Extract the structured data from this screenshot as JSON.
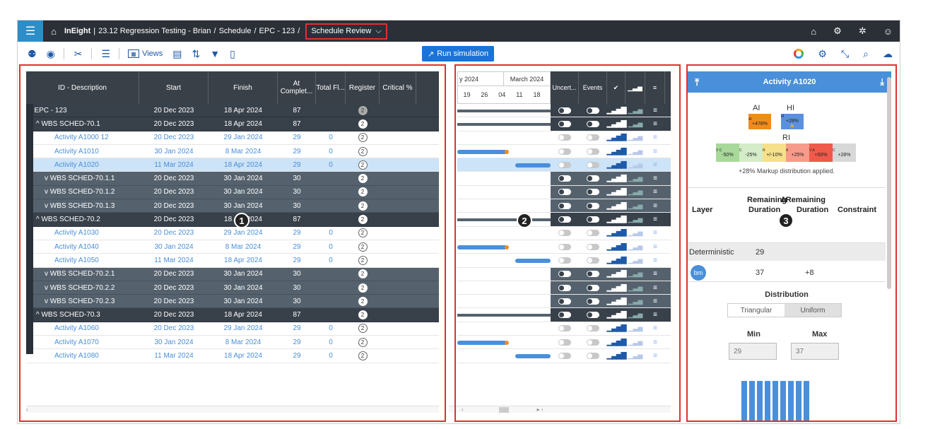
{
  "topbar": {
    "app": "InEight",
    "project": "23.12 Regression Testing - Brian",
    "path1": "Schedule",
    "path2": "EPC - 123",
    "current": "Schedule Review"
  },
  "toolbar": {
    "views_label": "Views",
    "run_label": "Run simulation"
  },
  "grid": {
    "headers": [
      "ID - Description",
      "Start",
      "Finish",
      "At Complet...",
      "Total Fl...",
      "Register",
      "Critical %"
    ],
    "rows": [
      {
        "kind": "dark",
        "r": "r0",
        "name": "^ EPC - 123",
        "start": "20 Dec 2023",
        "finish": "18 Apr 2024",
        "ac": "87",
        "tf": "",
        "reg": "2"
      },
      {
        "kind": "dark",
        "name": "^ WBS SCHED-70.1",
        "start": "20 Dec 2023",
        "finish": "18 Apr 2024",
        "ac": "87",
        "tf": "",
        "reg": "2"
      },
      {
        "kind": "act",
        "name": "Activity A1000 12",
        "start": "20 Dec 2023",
        "finish": "29 Jan 2024",
        "ac": "29",
        "tf": "0",
        "reg": "2"
      },
      {
        "kind": "act",
        "name": "Activity A1010",
        "start": "30 Jan 2024",
        "finish": "8 Mar 2024",
        "ac": "29",
        "tf": "0",
        "reg": "2"
      },
      {
        "kind": "sel",
        "name": "Activity A1020",
        "start": "11 Mar 2024",
        "finish": "18 Apr 2024",
        "ac": "29",
        "tf": "0",
        "reg": "2"
      },
      {
        "kind": "mid",
        "name": "v WBS SCHED-70.1.1",
        "start": "20 Dec 2023",
        "finish": "30 Jan 2024",
        "ac": "30",
        "tf": "",
        "reg": "2"
      },
      {
        "kind": "mid",
        "name": "v WBS SCHED-70.1.2",
        "start": "20 Dec 2023",
        "finish": "30 Jan 2024",
        "ac": "30",
        "tf": "",
        "reg": "2"
      },
      {
        "kind": "mid",
        "name": "v WBS SCHED-70.1.3",
        "start": "20 Dec 2023",
        "finish": "30 Jan 2024",
        "ac": "30",
        "tf": "",
        "reg": "2"
      },
      {
        "kind": "dark",
        "name": "^ WBS SCHED-70.2",
        "start": "20 Dec 2023",
        "finish": "18 Apr 2024",
        "ac": "87",
        "tf": "",
        "reg": "2"
      },
      {
        "kind": "act",
        "name": "Activity A1030",
        "start": "20 Dec 2023",
        "finish": "29 Jan 2024",
        "ac": "29",
        "tf": "0",
        "reg": "2"
      },
      {
        "kind": "act",
        "name": "Activity A1040",
        "start": "30 Jan 2024",
        "finish": "8 Mar 2024",
        "ac": "29",
        "tf": "0",
        "reg": "2"
      },
      {
        "kind": "act",
        "name": "Activity A1050",
        "start": "11 Mar 2024",
        "finish": "18 Apr 2024",
        "ac": "29",
        "tf": "0",
        "reg": "2"
      },
      {
        "kind": "mid",
        "name": "v WBS SCHED-70.2.1",
        "start": "20 Dec 2023",
        "finish": "30 Jan 2024",
        "ac": "30",
        "tf": "",
        "reg": "2"
      },
      {
        "kind": "mid",
        "name": "v WBS SCHED-70.2.2",
        "start": "20 Dec 2023",
        "finish": "30 Jan 2024",
        "ac": "30",
        "tf": "",
        "reg": "2"
      },
      {
        "kind": "mid",
        "name": "v WBS SCHED-70.2.3",
        "start": "20 Dec 2023",
        "finish": "30 Jan 2024",
        "ac": "30",
        "tf": "",
        "reg": "2"
      },
      {
        "kind": "dark",
        "name": "^ WBS SCHED-70.3",
        "start": "20 Dec 2023",
        "finish": "18 Apr 2024",
        "ac": "87",
        "tf": "",
        "reg": "2"
      },
      {
        "kind": "act",
        "name": "Activity A1060",
        "start": "20 Dec 2023",
        "finish": "29 Jan 2024",
        "ac": "29",
        "tf": "0",
        "reg": "2"
      },
      {
        "kind": "act",
        "name": "Activity A1070",
        "start": "30 Jan 2024",
        "finish": "8 Mar 2024",
        "ac": "29",
        "tf": "0",
        "reg": "2"
      },
      {
        "kind": "act",
        "name": "Activity A1080",
        "start": "11 Mar 2024",
        "finish": "18 Apr 2024",
        "ac": "29",
        "tf": "0",
        "reg": "2"
      }
    ]
  },
  "gantt": {
    "month_left": "y 2024",
    "month_right": "March 2024",
    "days": [
      "19",
      "26",
      "04",
      "11",
      "18"
    ],
    "cols": [
      "Uncert...",
      "Events"
    ]
  },
  "callouts": [
    "1",
    "2",
    "3"
  ],
  "side": {
    "title": "Activity A1020",
    "ai": "AI",
    "hi": "HI",
    "ri": "RI",
    "ai_val": "+478%",
    "hi_val": "+28%",
    "ai_tag": "AI",
    "hi_tag": "M",
    "ri_cells": [
      {
        "tag": "V C",
        "val": "-50%",
        "color": "#a8d89a"
      },
      {
        "tag": "C",
        "val": "-25%",
        "color": "#d4ecc8"
      },
      {
        "tag": "R",
        "val": "+/-10%",
        "color": "#f7e08a"
      },
      {
        "tag": "A",
        "val": "+25%",
        "color": "#f79a8a"
      },
      {
        "tag": "V A",
        "val": "+50%",
        "color": "#f05a4a"
      },
      {
        "tag": "C",
        "val": "+28%",
        "color": "#d8d8d8"
      }
    ],
    "markup_note": "+28% Markup distribution applied.",
    "col_layer": "Layer",
    "col_rem_a": "Remaining",
    "col_rem_b": "Duration",
    "col_drem_a": "∆Remaining",
    "col_drem_b": "Duration",
    "col_constraint": "Constraint",
    "det_label": "Deterministic",
    "det_val": "29",
    "bm_label": "bm",
    "bm_val": "37",
    "bm_delta": "+8",
    "dist_label": "Distribution",
    "dist_tri": "Triangular",
    "dist_uni": "Uniform",
    "min_label": "Min",
    "max_label": "Max",
    "min_val": "29",
    "max_val": "37"
  },
  "colors": {
    "accent": "#1a73d9",
    "header": "#2b2f36",
    "highlight": "#e03030"
  }
}
